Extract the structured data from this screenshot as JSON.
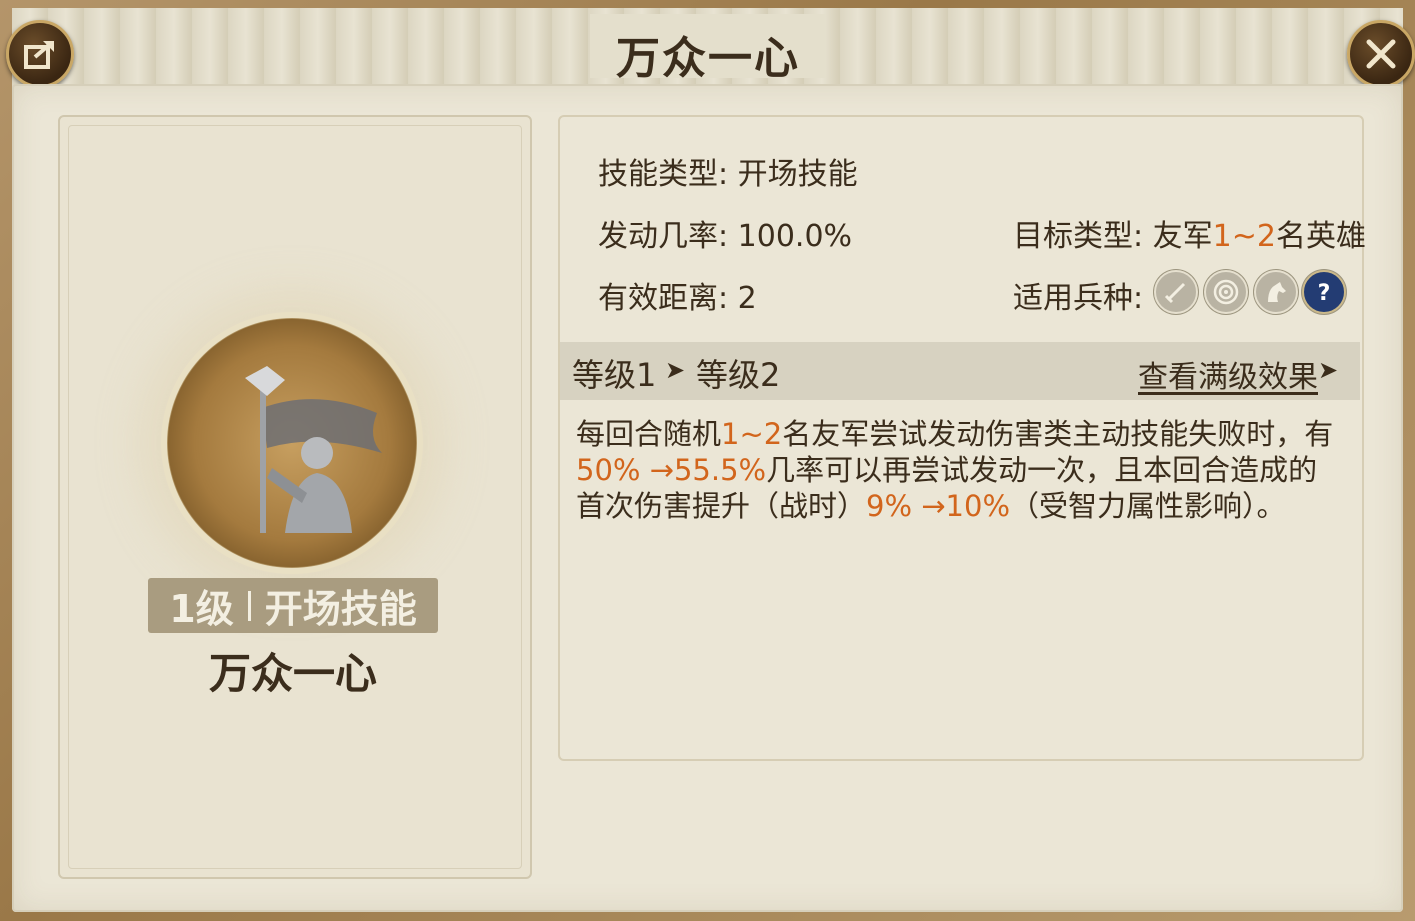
{
  "title": "万众一心",
  "left": {
    "level": "1级",
    "category": "开场技能",
    "name": "万众一心"
  },
  "info": {
    "skill_type_label": "技能类型:",
    "skill_type_value": "开场技能",
    "trigger_rate_label": "发动几率:",
    "trigger_rate_value": "100.0%",
    "range_label": "有效距离:",
    "range_value": "2",
    "target_label": "目标类型:",
    "target_prefix": "友军",
    "target_range": "1~2",
    "target_suffix": "名英雄",
    "troops_label": "适用兵种:",
    "troop_icons": [
      "sword-icon",
      "bow-target-icon",
      "horse-icon",
      "question-icon"
    ]
  },
  "levels": {
    "from": "等级1",
    "arrow": "➤",
    "to": "等级2",
    "view_max": "查看满级效果",
    "view_arrow": "➤"
  },
  "description": {
    "l1_a": "每回合随机",
    "l1_b": "1~2",
    "l1_c": "名友军尝试发动伤害类主动技能失败时，有",
    "l2_a": "50% →55.5%",
    "l2_b": "几率可以再尝试发动一次，且本回合造成的",
    "l3_a": "首次伤害提升（战时）",
    "l3_b": "9% →10%",
    "l3_c": "（受智力属性影响）。"
  },
  "colors": {
    "highlight": "#d2651c",
    "text": "#3b2d1c",
    "panel": "#ebe6d6"
  }
}
